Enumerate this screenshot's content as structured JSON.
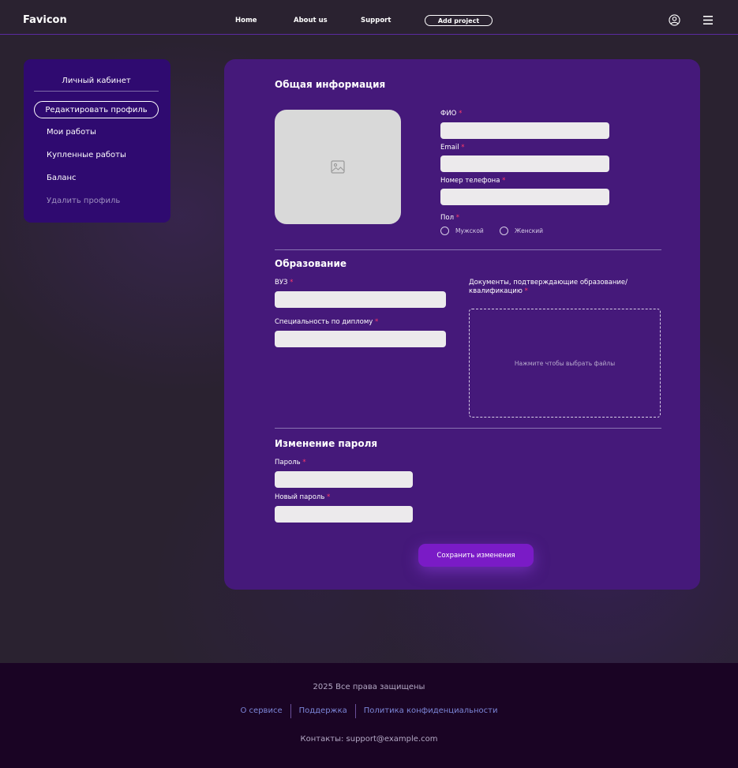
{
  "header": {
    "logo": "Favicon",
    "nav": [
      "Home",
      "About us",
      "Support"
    ],
    "add_project": "Add project",
    "icons": {
      "user": "user-circle-icon",
      "menu": "hamburger-menu-icon"
    }
  },
  "sidebar": {
    "title": "Личный кабинет",
    "items": [
      {
        "label": "Редактировать профиль",
        "active": true
      },
      {
        "label": "Мои работы"
      },
      {
        "label": "Купленные работы"
      },
      {
        "label": "Баланс"
      },
      {
        "label": "Удалить профиль",
        "muted": true
      }
    ]
  },
  "general": {
    "title": "Общая информация",
    "photo_icon": "image-placeholder-icon",
    "fio_label": "ФИО",
    "fio_value": "",
    "email_label": "Email",
    "email_value": "",
    "phone_label": "Номер телефона",
    "phone_value": "",
    "gender_label": "Пол",
    "gender_options": [
      "Мужской",
      "Женский"
    ]
  },
  "education": {
    "title": "Образование",
    "university_label": "ВУЗ",
    "university_value": "",
    "specialty_label": "Специальность по диплому",
    "specialty_value": "",
    "documents_label_line1": "Документы, подтверждающие образование/",
    "documents_label_line2": "квалификацию",
    "dropzone_text": "Нажмите чтобы выбрать файлы"
  },
  "password": {
    "title": "Изменение пароля",
    "password_label": "Пароль",
    "password_value": "",
    "new_password_label": "Новый пароль",
    "new_password_value": ""
  },
  "save_button": "Сохранить изменения",
  "required_mark": "*",
  "footer": {
    "copyright": "2025 Все права защищены",
    "links": [
      "О сервисе",
      "Поддержка",
      "Политика конфиденциальности"
    ],
    "contacts": "Контакты: support@example.com"
  },
  "colors": {
    "page_bg": "#2a2230",
    "sidebar_bg": "#2f0a70",
    "card_bg": "#45197a",
    "button_bg": "#7a1bc6",
    "footer_bg": "#1a0424",
    "link": "#7c86d8",
    "required": "#ff3a6a"
  }
}
